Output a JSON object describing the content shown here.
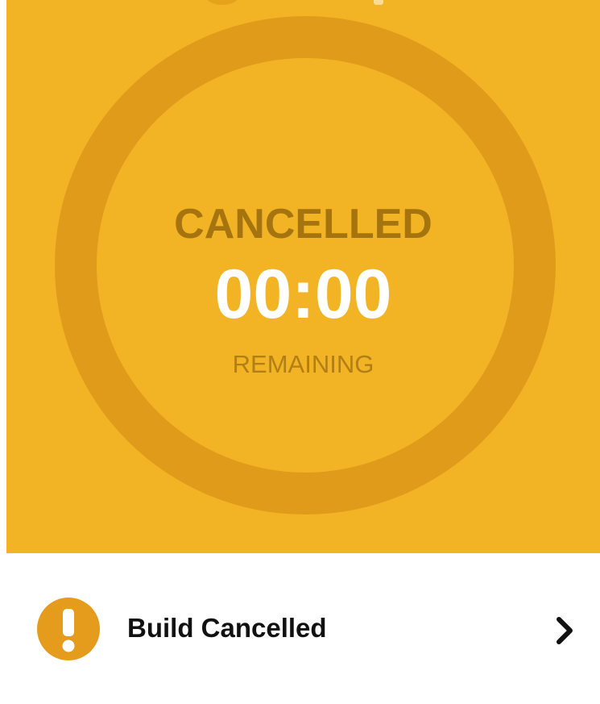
{
  "timer_card": {
    "state_label": "CANCELLED",
    "time_remaining": "00:00",
    "remaining_label": "REMAINING"
  },
  "build_status": {
    "label": "Build Cancelled",
    "icon": "exclamation-icon",
    "chevron_icon": "chevron-right-icon"
  },
  "colors": {
    "panel_background": "#f2b424",
    "ring": "#e09b1a",
    "state_text": "#a5740e",
    "timer_text": "#ffffff",
    "alert_icon": "#e59c1c"
  }
}
